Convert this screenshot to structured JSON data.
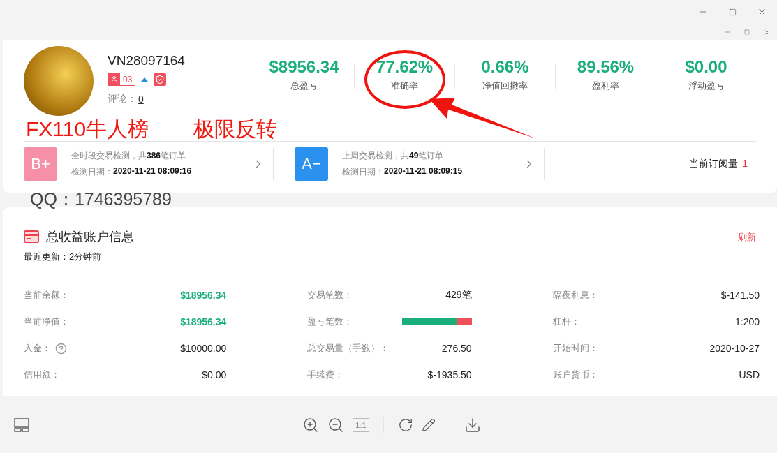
{
  "profile": {
    "account": "VN28097164",
    "followers": "03",
    "comments_label": "评论：",
    "comments": "0"
  },
  "stats": [
    {
      "value": "$8956.34",
      "label": "总盈亏",
      "circled": false
    },
    {
      "value": "77.62%",
      "label": "准确率",
      "circled": true
    },
    {
      "value": "0.66%",
      "label": "净值回撤率",
      "circled": false
    },
    {
      "value": "89.56%",
      "label": "盈利率",
      "circled": false
    },
    {
      "value": "$0.00",
      "label": "浮动盈亏",
      "circled": false
    }
  ],
  "annotations": {
    "title": "FX110牛人榜",
    "tag": "极限反转",
    "contact": "QQ：1746395789"
  },
  "grades": [
    {
      "grade": "B+",
      "color": "#f590a8",
      "summary": "全时段交易检测，共**386**笔订单",
      "date_label": "检测日期：",
      "date": "2020-11-21 08:09:16"
    },
    {
      "grade": "A−",
      "color": "#2a92ee",
      "summary": "上周交易检测，共**49**笔订单",
      "date_label": "检测日期：",
      "date": "2020-11-21 08:09:15"
    }
  ],
  "subscriptions": {
    "label": "当前订阅量",
    "count": "1"
  },
  "account_info": {
    "title": "总收益账户信息",
    "updated": "最近更新：2分钟前",
    "refresh": "刷新",
    "columns": [
      [
        {
          "label": "当前余额：",
          "value": "$18956.34",
          "kind": "highlight"
        },
        {
          "label": "当前净值：",
          "value": "$18956.34",
          "kind": "highlight"
        },
        {
          "label": "入金：",
          "value": "$10000.00",
          "kind": "help"
        },
        {
          "label": "信用额：",
          "value": "$0.00",
          "kind": "plain"
        }
      ],
      [
        {
          "label": "交易笔数：",
          "value": "429笔",
          "kind": "plain"
        },
        {
          "label": "盈亏笔数：",
          "level": 0.78,
          "kind": "bar"
        },
        {
          "label": "总交易量（手数）：",
          "value": "276.50",
          "kind": "plain"
        },
        {
          "label": "手续费：",
          "value": "$-1935.50",
          "kind": "plain"
        }
      ],
      [
        {
          "label": "隔夜利息：",
          "value": "$-141.50",
          "kind": "plain"
        },
        {
          "label": "杠杆：",
          "value": "1:200",
          "kind": "plain"
        },
        {
          "label": "开始时间：",
          "value": "2020-10-27",
          "kind": "plain"
        },
        {
          "label": "账户货币：",
          "value": "USD",
          "kind": "plain"
        }
      ]
    ]
  },
  "toolbar": {
    "actual_size": "1:1",
    "actual_size_disabled": true
  }
}
